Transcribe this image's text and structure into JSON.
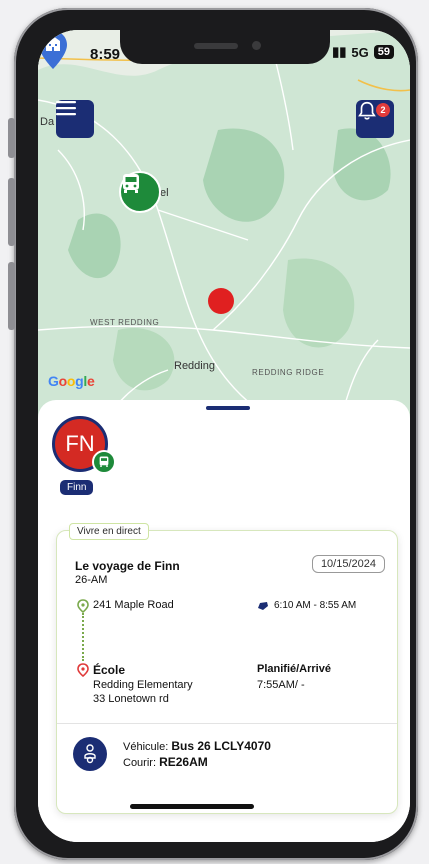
{
  "status_bar": {
    "time": "8:59",
    "network": "5G",
    "battery": "59"
  },
  "map": {
    "labels": {
      "west_redding": "WEST REDDING",
      "redding": "Redding",
      "redding_ridge": "REDDING RIDGE",
      "edge_left": "Da",
      "edge_bus": "el"
    },
    "google": "Google",
    "notification_count": "2"
  },
  "student": {
    "initials": "FN",
    "name": "Finn"
  },
  "trip": {
    "live_label": "Vivre en direct",
    "title": "Le voyage de Finn",
    "route": "26-AM",
    "date": "10/15/2024",
    "stop_address": "241 Maple Road",
    "time_range": "6:10 AM - 8:55 AM",
    "school_label": "École",
    "school_name": "Redding Elementary",
    "school_address": "33 Lonetown rd",
    "planned_label": "Planifié/Arrivé",
    "planned_value": "7:55AM/ -",
    "vehicle_label": "Véhicule:",
    "vehicle_value": "Bus 26 LCLY4070",
    "route_label": "Courir:",
    "route_value": "RE26AM"
  },
  "colors": {
    "navy": "#1b2d74",
    "bus_green": "#1e8a3a",
    "alert_red": "#e02020",
    "map_green": "#cfe6d4"
  },
  "icons": {
    "menu": "hamburger-icon",
    "bell": "bell-icon",
    "bus": "bus-icon",
    "school": "school-icon",
    "vehicle": "driver-icon"
  }
}
